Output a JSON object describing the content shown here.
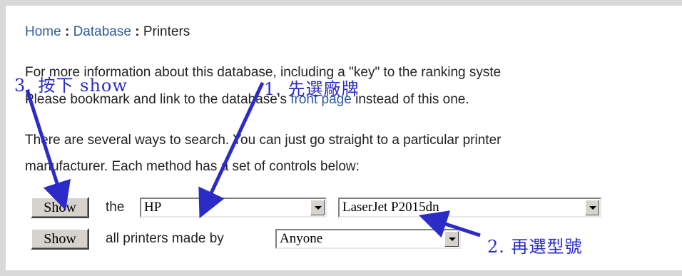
{
  "breadcrumb": {
    "home": "Home",
    "sep1": ":",
    "database": "Database",
    "sep2": ":",
    "current": "Printers"
  },
  "intro": {
    "line1": "For more information about this database, including a \"key\" to the ranking syste",
    "line2_pre": "Please bookmark and link to the database's ",
    "line2_link": "front page",
    "line2_post": " instead of this one.",
    "line3": "There are several ways to search. You can just go straight to a particular printer",
    "line4": "manufacturer. Each method has a set of controls below:"
  },
  "row1": {
    "button": "Show",
    "text": "the",
    "manufacturer": "HP",
    "model": "LaserJet P2015dn"
  },
  "row2": {
    "button": "Show",
    "text": "all printers made by",
    "maker": "Anyone"
  },
  "annotations": {
    "a1": "1. 先選廠牌",
    "a2": "2. 再選型號",
    "a3": "3. 按下 show"
  },
  "colors": {
    "link": "#2f5b9c",
    "annotation": "#2b2bc8",
    "background": "#d9d9d9"
  }
}
